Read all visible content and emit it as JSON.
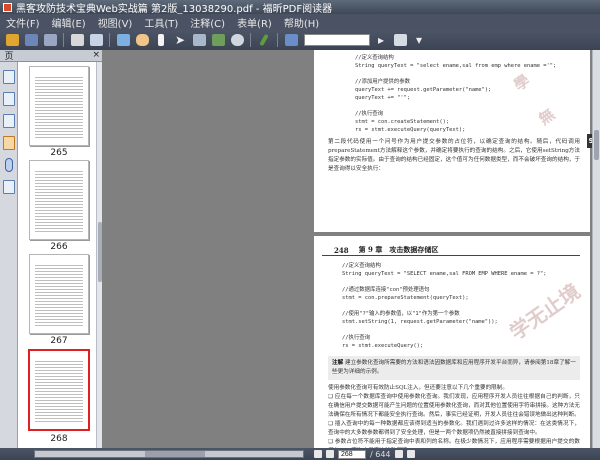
{
  "window": {
    "title": "黑客攻防技术宝典Web实战篇 第2版_13038290.pdf - 福昕PDF阅读器"
  },
  "menu": [
    {
      "label": "文件(F)"
    },
    {
      "label": "编辑(E)"
    },
    {
      "label": "视图(V)"
    },
    {
      "label": "工具(T)"
    },
    {
      "label": "注释(C)"
    },
    {
      "label": "表单(R)"
    },
    {
      "label": "帮助(H)"
    }
  ],
  "toolbar": {
    "icons": [
      "open-icon",
      "save-icon",
      "print-icon",
      "email-icon",
      "fullscreen-icon",
      "hand-icon",
      "select-text-icon",
      "select-pointer-icon",
      "snapshot-icon",
      "zoom-icon",
      "typewriter-icon",
      "find-icon"
    ],
    "search_value": ""
  },
  "panel": {
    "tab_label": "页",
    "close_label": "×"
  },
  "thumbnails": [
    {
      "number": "265",
      "selected": false
    },
    {
      "number": "266",
      "selected": false
    },
    {
      "number": "267",
      "selected": false
    },
    {
      "number": "268",
      "selected": true
    }
  ],
  "doc": {
    "page1": {
      "code_lines": [
        "    //定义查询结构",
        "    String queryText = \"select ename,sal from emp where ename ='\";",
        "",
        "    //添加用户提供的参数",
        "    queryText += request.getParameter(\"name\");",
        "    queryText += \"'\";",
        "",
        "    //执行查询",
        "    stmt = con.createStatement();",
        "    rs = stmt.executeQuery(queryText);"
      ],
      "paragraph": "第二段代码使用一个问号作为用户提交参数的占位符，以确定查询的结构。随后，代码调用prepareStatement方法解释这个参数，并确定将要执行的查询的结构。之后，它使用setString方法指定参数的实际值。由于查询的结构已经固定，这个值可为任何数据类型，而不会破坏查询的结构，于是查询得以安全执行："
    },
    "page2": {
      "page_number": "248",
      "chapter_title": "第 9 章　攻击数据存储区",
      "code_lines": [
        "//定义查询结构",
        "String queryText = \"SELECT ename,sal FROM EMP WHERE ename = ?\";",
        "",
        "//通过数据库连接\"con\"预处理语句",
        "stmt = con.prepareStatement(queryText);",
        "",
        "//使用\"?\"输入的参数值，以\"1\"作为第一个参数",
        "stmt.setString(1, request.getParameter(\"name\"));",
        "",
        "//执行查询",
        "rs = stmt.executeQuery();"
      ],
      "note_label": "注解",
      "note_text": "建立参数化查询所需要的方法和语法因数据库和应用程序开发平台而异，请参阅第18章了解一些更为详细的示例。",
      "intro": "使用参数化查询可有效防止SQL注入，但还要注意以下几个重要的限制。",
      "bullets": [
        "应在每一个数据库查询中使用参数化查询。我们发现，应用程序开发人员往往根据自己的判断，只在确信用户提交数据可能产生问题的位置使用参数化查询，而对其他位置使用字符串拼接。这种方法无法确保在所有情况下都能安全执行查询。然后，事实已经证明，开发人员往往会错误地做出这种判断。",
        "插入查询中的每一种数据都应该得到适当的参数化。我们遇到过许多这样的情况：在这类情况下，查询中的大多数参数都得到了安全处理，但是一两个数据项仍然被直接拼接到查询中。",
        "参数占位符不能用于指定查询中表和列的名称。在极少数情况下，应用程序需要根据用户提交的数据在SQL查询中指定这些数据项。"
      ],
      "watermark": "学无止境"
    },
    "side_tab": "9"
  },
  "status": {
    "current_page": "268",
    "total_pages": "/ 644"
  }
}
